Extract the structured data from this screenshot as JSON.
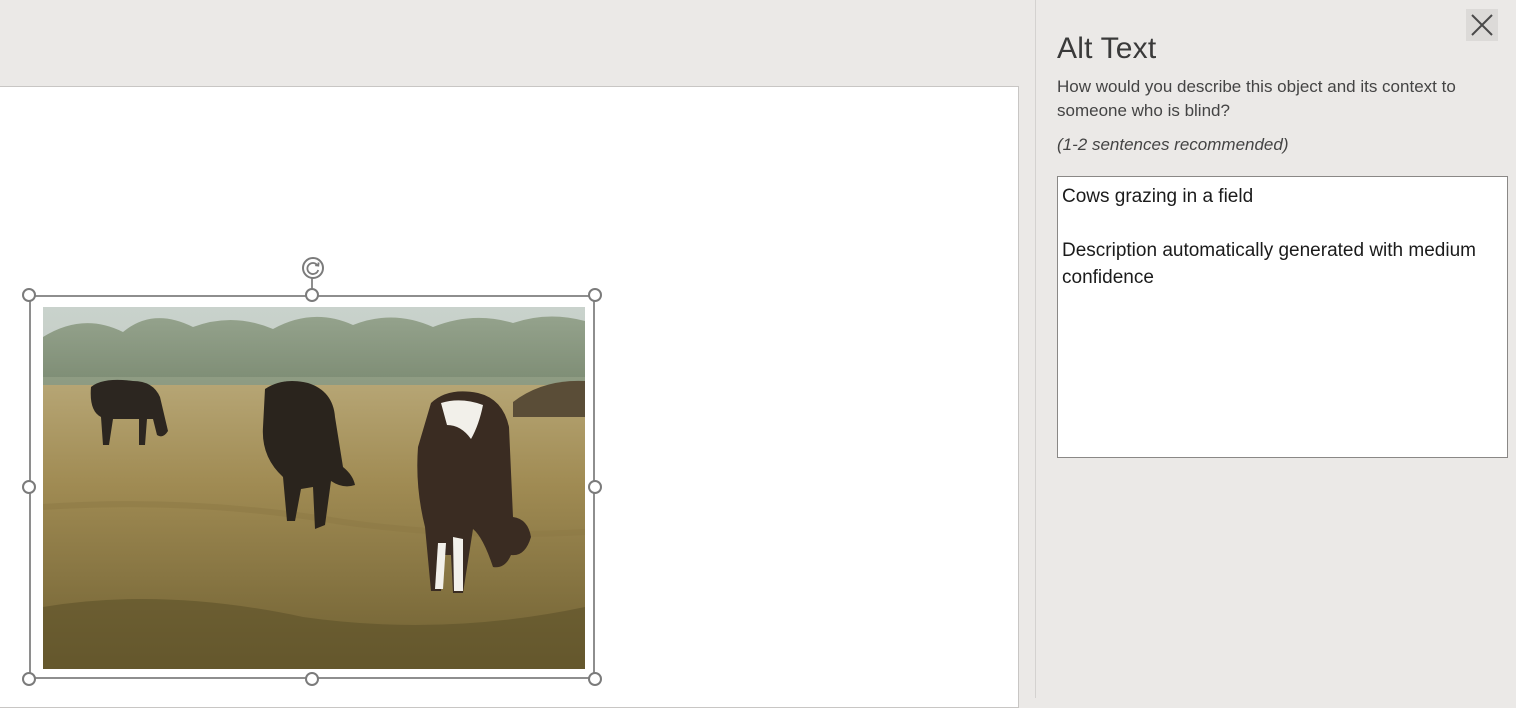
{
  "alt_text_pane": {
    "title": "Alt Text",
    "close_label": "close",
    "prompt": "How would you describe this object and its context to someone who is blind?",
    "hint": "(1-2 sentences recommended)",
    "description_value": "Cows grazing in a field\n\nDescription automatically generated with medium confidence"
  },
  "document": {
    "selected_object": "image"
  },
  "colors": {
    "pane_background": "#ebe9e7",
    "page_background": "#ffffff",
    "handle_stroke": "#7b7b7b"
  },
  "icons": {
    "close": "close-icon",
    "rotate": "rotate-handle-icon"
  }
}
